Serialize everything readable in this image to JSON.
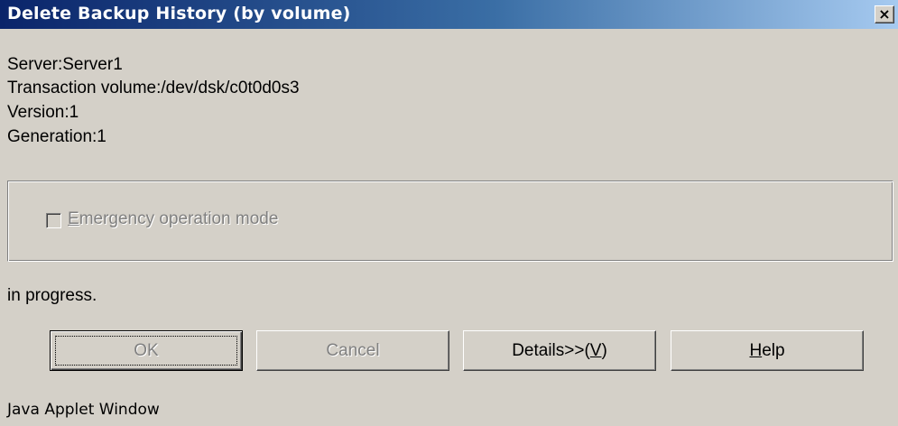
{
  "window": {
    "title": "Delete Backup History (by volume)",
    "close_label": "×"
  },
  "info": {
    "server": "Server:Server1",
    "transaction_volume": "Transaction volume:/dev/dsk/c0t0d0s3",
    "version": "Version:1",
    "generation": "Generation:1"
  },
  "options": {
    "emergency_mode": {
      "label_mnemonic": "E",
      "label_rest": "mergency operation mode",
      "checked": false,
      "enabled": false
    }
  },
  "status": "in progress.",
  "buttons": {
    "ok": "OK",
    "cancel": "Cancel",
    "details": {
      "prefix": "Details>>(",
      "mnemonic": "V",
      "suffix": ")"
    },
    "help": {
      "mnemonic": "H",
      "rest": "elp"
    }
  },
  "footer": "Java Applet Window"
}
